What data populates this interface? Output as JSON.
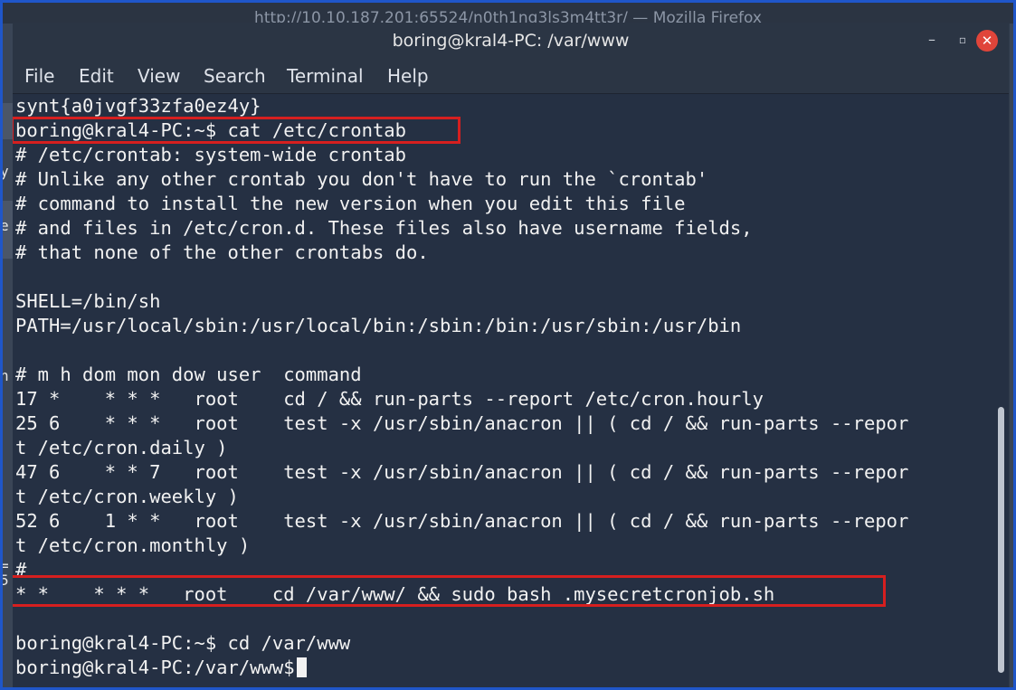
{
  "background_browser": {
    "title": "http://10.10.187.201:65524/n0th1ng3ls3m4tt3r/ — Mozilla Firefox",
    "edge_glyphs": [
      "y",
      "e",
      "h",
      "=",
      "5"
    ]
  },
  "window": {
    "title": "boring@kral4-PC: /var/www",
    "minimize_label": "–",
    "maximize_label": "▫",
    "close_label": "✕"
  },
  "menu": [
    "File",
    "Edit",
    "View",
    "Search",
    "Terminal",
    "Help"
  ],
  "terminal_lines": [
    "synt{a0jvgf33zfa0ez4y}",
    "boring@kral4-PC:~$ cat /etc/crontab",
    "# /etc/crontab: system-wide crontab",
    "# Unlike any other crontab you don't have to run the `crontab'",
    "# command to install the new version when you edit this file",
    "# and files in /etc/cron.d. These files also have username fields,",
    "# that none of the other crontabs do.",
    "",
    "SHELL=/bin/sh",
    "PATH=/usr/local/sbin:/usr/local/bin:/sbin:/bin:/usr/sbin:/usr/bin",
    "",
    "# m h dom mon dow user  command",
    "17 *    * * *   root    cd / && run-parts --report /etc/cron.hourly",
    "25 6    * * *   root    test -x /usr/sbin/anacron || ( cd / && run-parts --repor",
    "t /etc/cron.daily )",
    "47 6    * * 7   root    test -x /usr/sbin/anacron || ( cd / && run-parts --repor",
    "t /etc/cron.weekly )",
    "52 6    1 * *   root    test -x /usr/sbin/anacron || ( cd / && run-parts --repor",
    "t /etc/cron.monthly )",
    "#",
    "* *    * * *   root    cd /var/www/ && sudo bash .mysecretcronjob.sh",
    "",
    "boring@kral4-PC:~$ cd /var/www",
    "boring@kral4-PC:/var/www$"
  ],
  "highlights": [
    "cat-crontab-command",
    "secret-cronjob-entry"
  ],
  "colors": {
    "terminal_bg": "#253043",
    "text": "#f2f2f2",
    "highlight": "#d61f1f",
    "frame": "#1f56c9",
    "close_button": "#e0453a"
  }
}
